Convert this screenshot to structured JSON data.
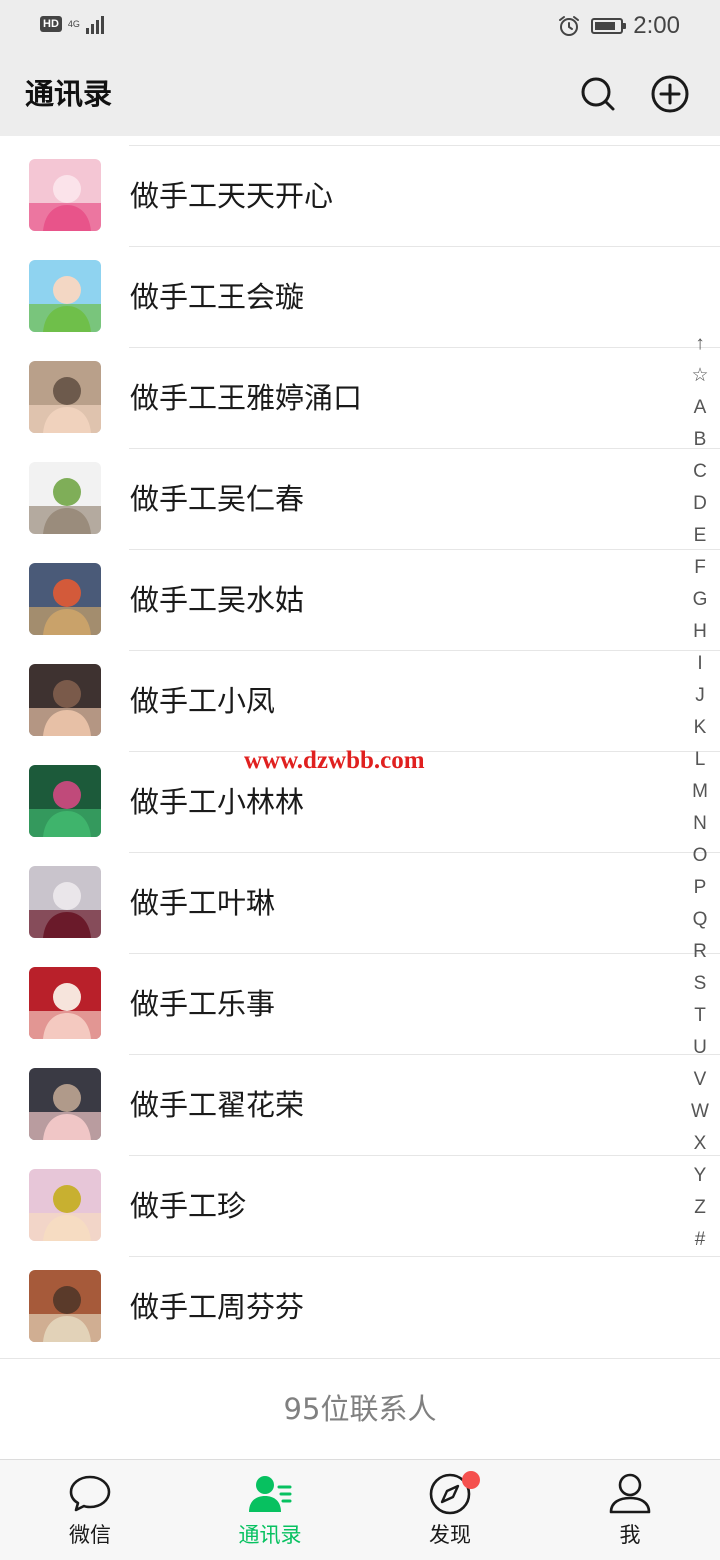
{
  "status_bar": {
    "hd": "HD",
    "network": "4G",
    "time": "2:00",
    "battery_level": 0.85
  },
  "header": {
    "title": "通讯录",
    "search_icon": "search-icon",
    "add_icon": "plus-circle-icon"
  },
  "contacts": [
    {
      "name": "做手工天天开心",
      "avatar_colors": [
        "#f4c6d4",
        "#e8548a",
        "#fbe3ea"
      ]
    },
    {
      "name": "做手工王会璇",
      "avatar_colors": [
        "#8fd3f0",
        "#6fbf4a",
        "#f3d7c4"
      ]
    },
    {
      "name": "做手工王雅婷涌口",
      "avatar_colors": [
        "#b9a08a",
        "#f0d2bd",
        "#6d5a4c"
      ]
    },
    {
      "name": "做手工吴仁春",
      "avatar_colors": [
        "#f2f2f2",
        "#9a8c7c",
        "#7fae58"
      ]
    },
    {
      "name": "做手工吴水姑",
      "avatar_colors": [
        "#4a5a78",
        "#c9a26a",
        "#d35a3a"
      ]
    },
    {
      "name": "做手工小凤",
      "avatar_colors": [
        "#3e3230",
        "#e7c0a6",
        "#7a5a4a"
      ]
    },
    {
      "name": "做手工小林林",
      "avatar_colors": [
        "#1c5a3a",
        "#3fb46c",
        "#c04a7a"
      ]
    },
    {
      "name": "做手工叶琳",
      "avatar_colors": [
        "#c9c4cc",
        "#6a1a2a",
        "#eae6ea"
      ]
    },
    {
      "name": "做手工乐事",
      "avatar_colors": [
        "#b9202a",
        "#f4c9c0",
        "#f6e4dc"
      ]
    },
    {
      "name": "做手工翟花荣",
      "avatar_colors": [
        "#3a3a44",
        "#f0c6c6",
        "#b09a8a"
      ]
    },
    {
      "name": "做手工珍",
      "avatar_colors": [
        "#e7c6d8",
        "#f6dcc2",
        "#c8b030"
      ]
    },
    {
      "name": "做手工周芬芬",
      "avatar_colors": [
        "#a65a3a",
        "#e2d2b8",
        "#5a3a2a"
      ]
    }
  ],
  "index_bar": [
    "↑",
    "☆",
    "A",
    "B",
    "C",
    "D",
    "E",
    "F",
    "G",
    "H",
    "I",
    "J",
    "K",
    "L",
    "M",
    "N",
    "O",
    "P",
    "Q",
    "R",
    "S",
    "T",
    "U",
    "V",
    "W",
    "X",
    "Y",
    "Z",
    "#"
  ],
  "watermark": "www.dzwbb.com",
  "contact_count": "95位联系人",
  "tabs": [
    {
      "label": "微信",
      "icon": "chat-bubble-icon",
      "active": false
    },
    {
      "label": "通讯录",
      "icon": "contacts-icon",
      "active": true
    },
    {
      "label": "发现",
      "icon": "compass-icon",
      "active": false,
      "badge": true
    },
    {
      "label": "我",
      "icon": "person-icon",
      "active": false
    }
  ],
  "colors": {
    "accent": "#07c160",
    "badge": "#f5504e",
    "header_bg": "#ededed",
    "watermark": "#e0201f"
  }
}
